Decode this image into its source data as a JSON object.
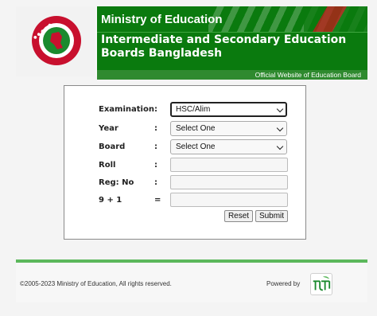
{
  "header": {
    "ministry": "Ministry of Education",
    "board_title": "Intermediate and Secondary Education Boards Bangladesh",
    "official_note": "Official Website of Education Board",
    "logo_icon": "bangladesh-govt-seal-icon"
  },
  "form": {
    "examination": {
      "label": "Examination",
      "colon": ":",
      "value": "HSC/Alim"
    },
    "year": {
      "label": "Year",
      "colon": ":",
      "value": "Select One"
    },
    "board": {
      "label": "Board",
      "colon": ":",
      "value": "Select One"
    },
    "roll": {
      "label": "Roll",
      "colon": ":",
      "value": ""
    },
    "reg": {
      "label": "Reg: No",
      "colon": ":",
      "value": ""
    },
    "captcha": {
      "label": "9 + 1",
      "colon": "=",
      "value": ""
    },
    "reset_label": "Reset",
    "submit_label": "Submit"
  },
  "footer": {
    "copyright": "©2005-2023 Ministry of Education, All rights reserved.",
    "powered_by": "Powered by",
    "sponsor_icon": "teletalk-logo-icon"
  },
  "colors": {
    "header_green": "#0a7a0e",
    "footer_accent": "#5cb85c"
  }
}
